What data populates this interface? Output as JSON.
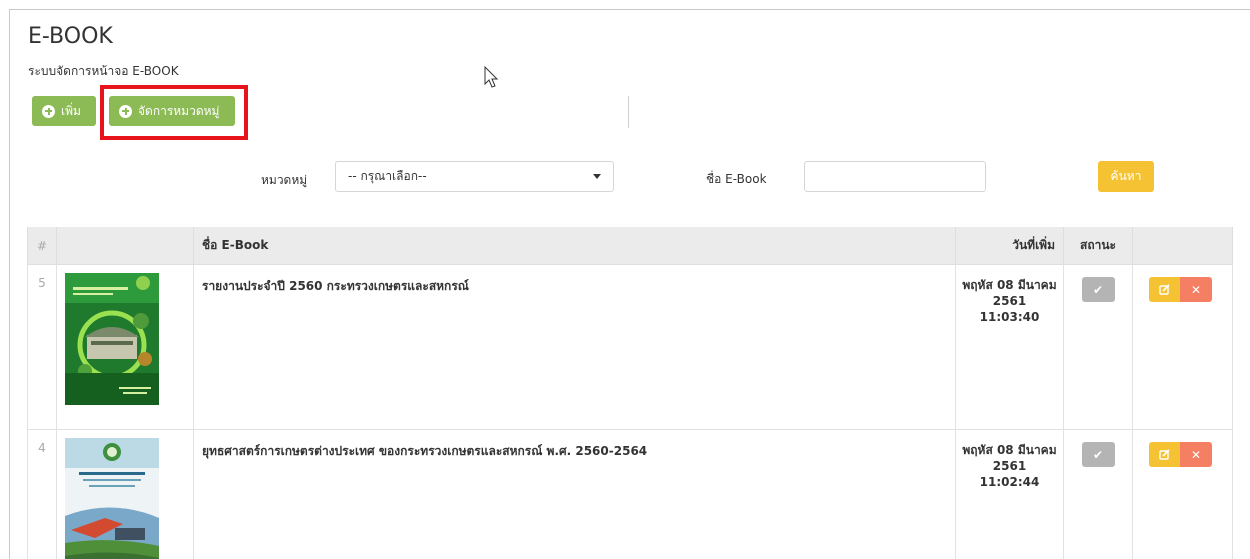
{
  "page": {
    "title": "E-BOOK",
    "subtitle": "ระบบจัดการหน้าจอ E-BOOK"
  },
  "toolbar": {
    "add_label": "เพิ่ม",
    "category_label": "จัดการหมวดหมู่"
  },
  "filters": {
    "category_label": "หมวดหมู่",
    "category_selected": "-- กรุณาเลือก--",
    "name_label": "ชื่อ E-Book",
    "name_value": "",
    "search_label": "ค้นหา"
  },
  "table": {
    "headers": {
      "num": "#",
      "image": "",
      "name": "ชื่อ E-Book",
      "date": "วันที่เพิ่ม",
      "status": "สถานะ",
      "action": ""
    },
    "rows": [
      {
        "num": "5",
        "name": "รายงานประจำปี 2560 กระทรวงเกษตรและสหกรณ์",
        "date_line1": "พฤหัส 08 มีนาคม",
        "date_line2": "2561 11:03:40"
      },
      {
        "num": "4",
        "name": "ยุทธศาสตร์การเกษตรต่างประเทศ ของกระทรวงเกษตรและสหกรณ์ พ.ศ. 2560-2564",
        "date_line1": "พฤหัส 08 มีนาคม",
        "date_line2": "2561 11:02:44"
      }
    ]
  },
  "icons": {
    "plus": "plus-circle-icon",
    "check": "check-icon",
    "edit": "edit-icon",
    "delete": "close-icon",
    "caret": "caret-down-icon",
    "cursor": "mouse-cursor-icon"
  },
  "colors": {
    "green": "#8cba54",
    "yellow": "#f5c233",
    "salmon": "#f47f62",
    "grey": "#b4b4b4",
    "highlight": "#e8141c"
  }
}
